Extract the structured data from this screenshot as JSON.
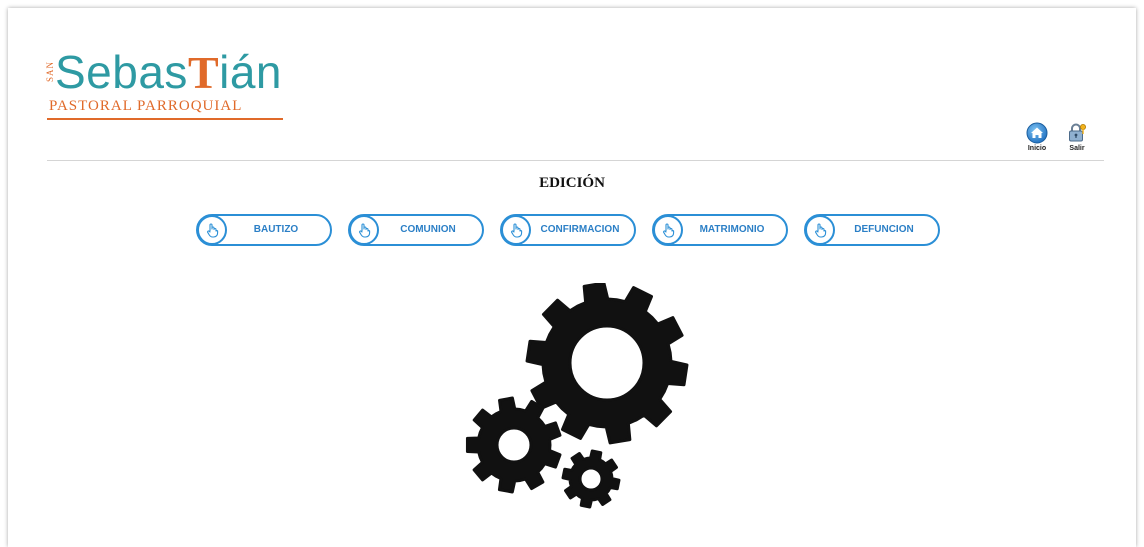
{
  "logo": {
    "side_text": "SAN",
    "word_before": "Sebas",
    "word_tau": "T",
    "word_after": "ián",
    "subtitle": "PASTORAL PARROQUIAL"
  },
  "header": {
    "home": {
      "label": "Inicio",
      "icon": "home-icon"
    },
    "logout": {
      "label": "Salir",
      "icon": "padlock-key-icon"
    }
  },
  "page": {
    "title": "EDICIÓN"
  },
  "buttons": [
    {
      "label": "BAUTIZO",
      "icon": "pointing-hand-icon"
    },
    {
      "label": "COMUNION",
      "icon": "pointing-hand-icon"
    },
    {
      "label": "CONFIRMACION",
      "icon": "pointing-hand-icon"
    },
    {
      "label": "MATRIMONIO",
      "icon": "pointing-hand-icon"
    },
    {
      "label": "DEFUNCION",
      "icon": "pointing-hand-icon"
    }
  ],
  "illustration": {
    "icon": "gears-icon"
  },
  "colors": {
    "brand_teal": "#2e9aa3",
    "brand_orange": "#e06a2a",
    "button_blue": "#2b8fd6",
    "gear_black": "#111111"
  }
}
